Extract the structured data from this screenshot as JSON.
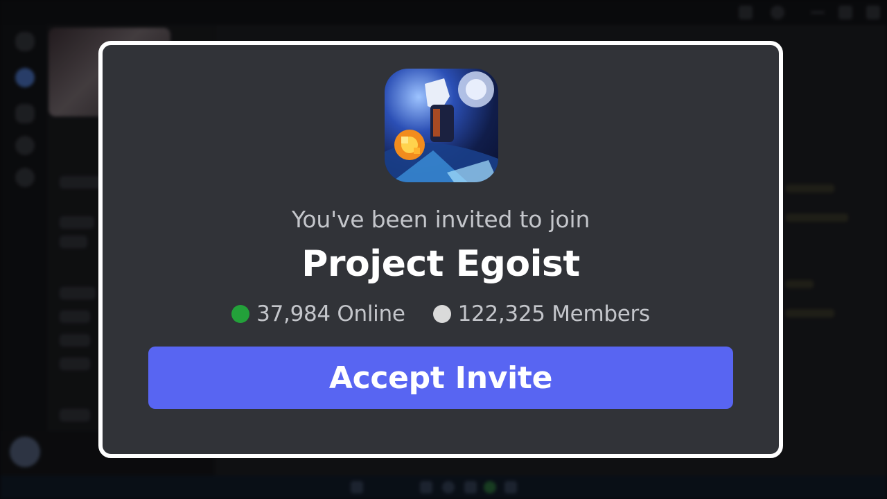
{
  "modal": {
    "invite_text": "You've been invited to join",
    "server_name": "Project Egoist",
    "online_count": "37,984 Online",
    "member_count": "122,325 Members",
    "accept_label": "Accept Invite"
  },
  "colors": {
    "online_dot": "#23a13a",
    "members_dot": "#dadada",
    "accept_button": "#5865f2",
    "modal_background": "#313338",
    "modal_border": "#ffffff"
  },
  "icons": {
    "server_icon": "server-icon",
    "online_indicator": "online-status-dot",
    "members_indicator": "members-status-dot"
  }
}
